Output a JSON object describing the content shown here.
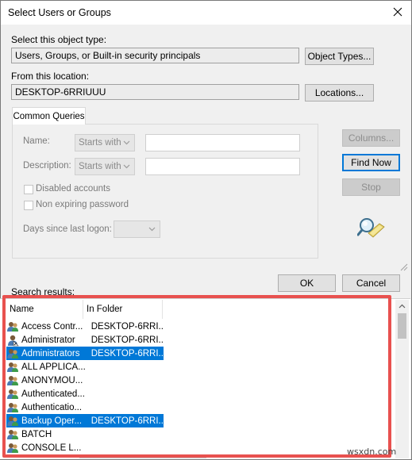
{
  "window": {
    "title": "Select Users or Groups"
  },
  "object_type": {
    "label": "Select this object type:",
    "value": "Users, Groups, or Built-in security principals",
    "button": "Object Types..."
  },
  "location": {
    "label": "From this location:",
    "value": "DESKTOP-6RRIUUU",
    "button": "Locations..."
  },
  "queries": {
    "tab_label": "Common Queries",
    "name_label": "Name:",
    "description_label": "Description:",
    "starts_with": "Starts with",
    "disabled_accounts": "Disabled accounts",
    "non_expiring": "Non expiring password",
    "days_label": "Days since last logon:"
  },
  "side_buttons": {
    "columns": "Columns...",
    "find_now": "Find Now",
    "stop": "Stop"
  },
  "footer": {
    "ok": "OK",
    "cancel": "Cancel"
  },
  "results": {
    "label": "Search results:",
    "columns": [
      "Name",
      "In Folder"
    ],
    "rows": [
      {
        "name": "Access Contr...",
        "folder": "DESKTOP-6RRI...",
        "selected": false,
        "icon": "group-icon"
      },
      {
        "name": "Administrator",
        "folder": "DESKTOP-6RRI...",
        "selected": false,
        "icon": "user-icon"
      },
      {
        "name": "Administrators",
        "folder": "DESKTOP-6RRI...",
        "selected": true,
        "icon": "group-icon"
      },
      {
        "name": "ALL APPLICA...",
        "folder": "",
        "selected": false,
        "icon": "group-icon"
      },
      {
        "name": "ANONYMOU...",
        "folder": "",
        "selected": false,
        "icon": "group-icon"
      },
      {
        "name": "Authenticated...",
        "folder": "",
        "selected": false,
        "icon": "group-icon"
      },
      {
        "name": "Authenticatio...",
        "folder": "",
        "selected": false,
        "icon": "group-icon"
      },
      {
        "name": "Backup Oper...",
        "folder": "DESKTOP-6RRI...",
        "selected": true,
        "icon": "group-icon"
      },
      {
        "name": "BATCH",
        "folder": "",
        "selected": false,
        "icon": "group-icon"
      },
      {
        "name": "CONSOLE L...",
        "folder": "",
        "selected": false,
        "icon": "group-icon"
      }
    ]
  },
  "watermark": "wsxdn.com",
  "colors": {
    "selection": "#0078d7",
    "highlight_border": "#e8514f"
  }
}
